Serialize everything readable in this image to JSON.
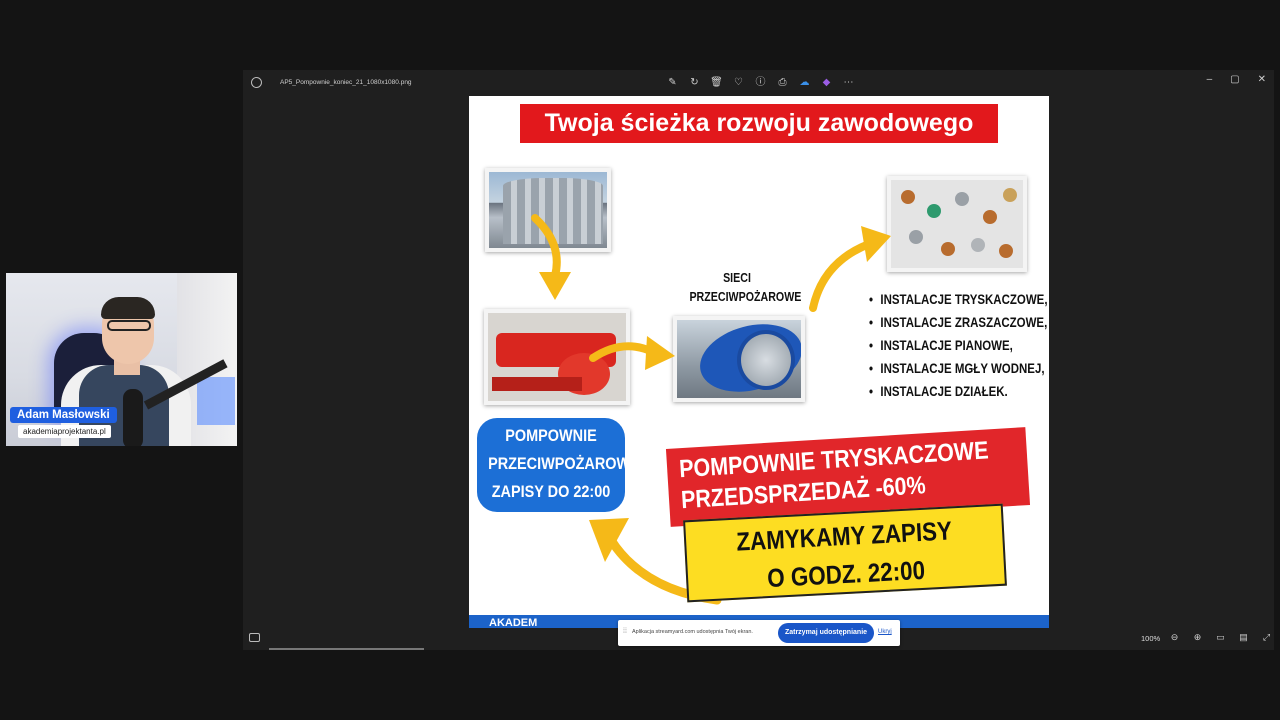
{
  "webcam": {
    "name": "Adam Masłowski",
    "site": "akademiaprojektanta.pl"
  },
  "window": {
    "file_name": "AP5_Pompownie_koniec_21_1080x1080.png",
    "toolbar_icons": [
      "edit-icon",
      "rotate-icon",
      "delete-icon",
      "favorite-icon",
      "info-icon",
      "print-icon",
      "onedrive-icon",
      "clipchamp-icon",
      "more-icon"
    ],
    "toolbar_glyphs": [
      "✎",
      "↻",
      "🗑",
      "♡",
      "ⓘ",
      "⎙",
      "☁",
      "◆",
      "⋯"
    ],
    "controls": {
      "minimize": "–",
      "maximize": "▢",
      "close": "✕"
    }
  },
  "image": {
    "headline": "Twoja ścieżka rozwoju zawodowego",
    "pipes_label": [
      "SIECI",
      "PRZECIWPOŻAROWE"
    ],
    "installations": [
      "INSTALACJE TRYSKACZOWE,",
      "INSTALACJE ZRASZACZOWE,",
      "INSTALACJE PIANOWE,",
      "INSTALACJE MGŁY WODNEJ,",
      "INSTALACJE DZIAŁEK."
    ],
    "pill": [
      "POMPOWNIE",
      "PRZECIWPOŻAROWE",
      "ZAPISY DO 22:00"
    ],
    "red_banner": [
      "POMPOWNIE TRYSKACZOWE",
      "PRZEDSPRZEDAŻ -60%"
    ],
    "yellow_banner": [
      "ZAMYKAMY ZAPISY",
      "O GODZ. 22:00"
    ],
    "footer": "AKADEM",
    "colors": {
      "red": "#e2181c",
      "blue": "#1c6fd6",
      "yellow": "#fddd22",
      "arrow": "#f5b918"
    }
  },
  "bottombar": {
    "zoom": "100%",
    "tools": [
      "zoom-out-icon",
      "zoom-in-icon",
      "fit-icon",
      "actual-size-icon",
      "fullscreen-icon"
    ],
    "tool_glyphs": [
      "⊖",
      "⊕",
      "▭",
      "▤",
      "⤢"
    ]
  },
  "share_notice": {
    "text": "Aplikacja streamyard.com udostępnia Twój ekran.",
    "stop_button": "Zatrzymaj udostępnianie",
    "hide_link": "Ukryj",
    "grip": "⁞⁞"
  }
}
